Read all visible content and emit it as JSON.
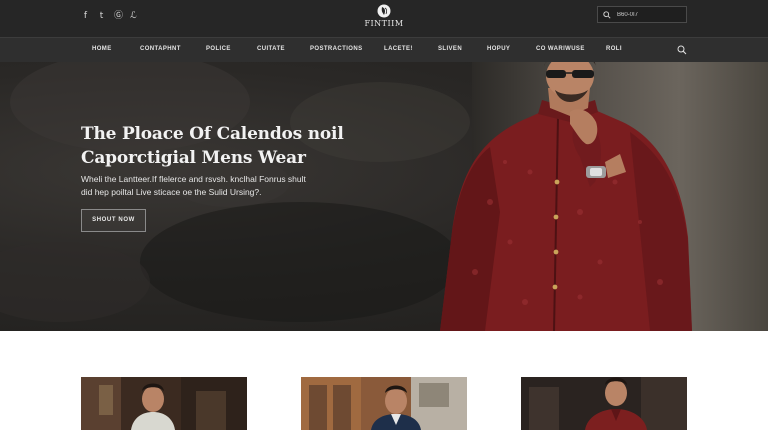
{
  "header": {
    "social_icons": [
      "facebook-icon",
      "twitter-icon",
      "instagram-icon",
      "pinterest-icon"
    ],
    "social_glyphs": [
      "f",
      "t",
      "Ⓖ",
      "ℒ"
    ],
    "logo_text": "FINTIIM",
    "search": {
      "value": "",
      "placeholder": "B60-0I7"
    }
  },
  "nav": {
    "items": [
      "HOME",
      "CONTAPHNT",
      "POLICE",
      "CUITATE",
      "POSTRACTIONS",
      "LACETE!",
      "SLIVEN",
      "HOPUY",
      "CO WARIWUSE",
      "ROLI"
    ]
  },
  "hero": {
    "title_line1": "The Ploace Of Calendos noil",
    "title_line2": "Caporctigial Mens Wear",
    "subtitle_line1": "Wheli the Lantteer.If flelerce and rsvsh. knclhal Fonrus shult",
    "subtitle_line2": "did hep poiltal Live sticace oe the Sulid Ursing?.",
    "cta_label": "SHOUT NOW"
  },
  "products": {
    "cards": [
      "product-card-1",
      "product-card-2",
      "product-card-3"
    ]
  },
  "colors": {
    "topbar": "#262626",
    "navbar": "#2f2f2f",
    "jacket": "#7c1f1f",
    "page": "#ffffff"
  }
}
